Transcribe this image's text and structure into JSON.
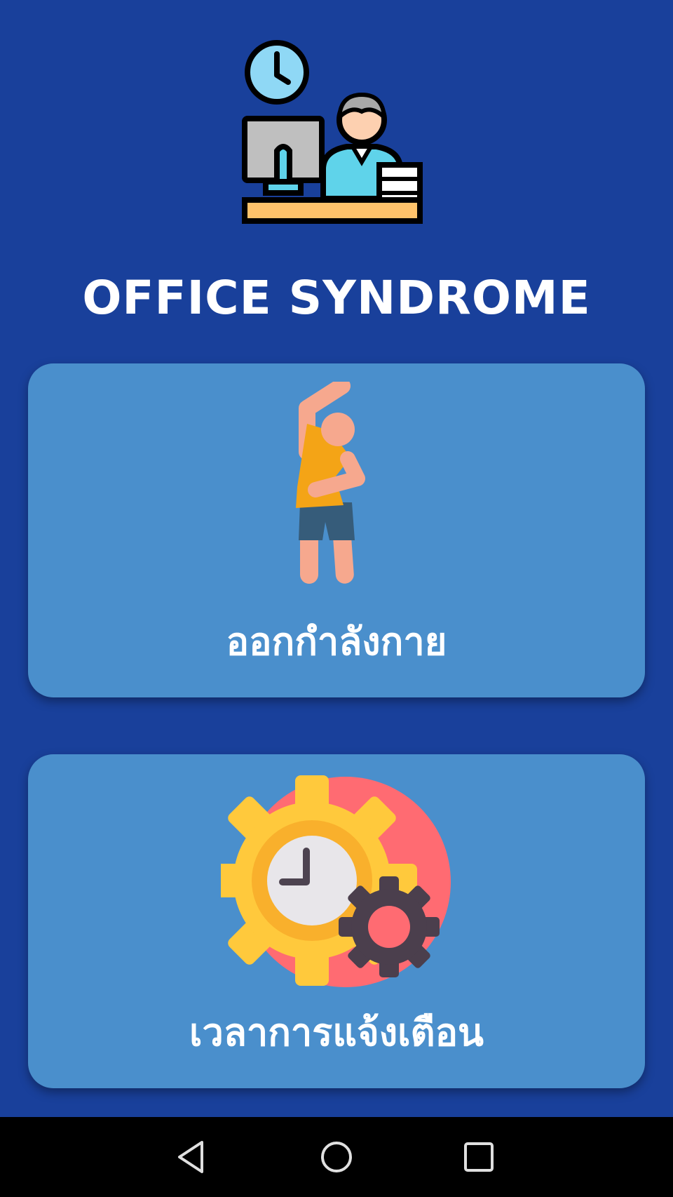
{
  "app": {
    "title": "OFFICE SYNDROME",
    "logo_icon": "office-worker-desk-icon"
  },
  "menu": {
    "items": [
      {
        "label": "ออกกำลังกาย",
        "icon": "stretching-person-icon"
      },
      {
        "label": "เวลาการแจ้งเตือน",
        "icon": "gear-clock-icon"
      }
    ]
  },
  "navbar": {
    "buttons": [
      "back-icon",
      "home-icon",
      "recent-apps-icon"
    ]
  },
  "colors": {
    "background": "#19409b",
    "card": "#4a8fcc",
    "text": "#ffffff",
    "navbar": "#000000"
  }
}
